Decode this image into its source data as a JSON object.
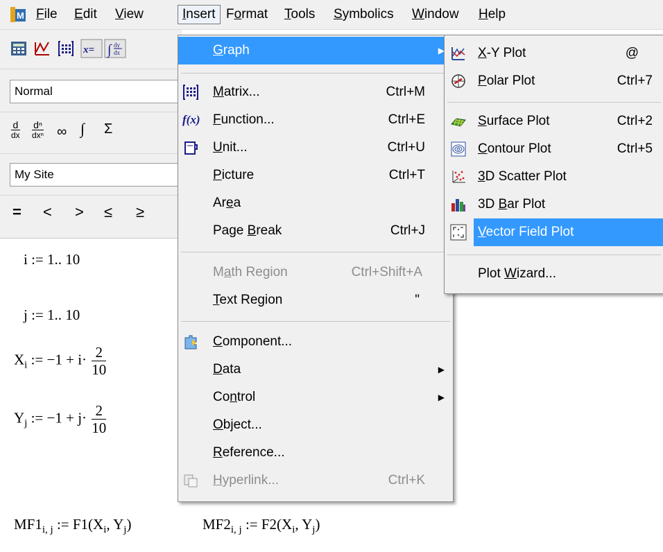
{
  "menubar": {
    "items": [
      {
        "label": "File",
        "mn": "F",
        "rest": "ile"
      },
      {
        "label": "Edit",
        "mn": "E",
        "rest": "dit"
      },
      {
        "label": "View",
        "mn": "V",
        "rest": "iew"
      },
      {
        "label": "Insert",
        "mn": "I",
        "rest": "nsert"
      },
      {
        "label": "Format",
        "pre": "F",
        "mn": "o",
        "rest": "rmat"
      },
      {
        "label": "Tools",
        "mn": "T",
        "rest": "ools"
      },
      {
        "label": "Symbolics",
        "mn": "S",
        "rest": "ymbolics"
      },
      {
        "label": "Window",
        "mn": "W",
        "rest": "indow"
      },
      {
        "label": "Help",
        "mn": "H",
        "rest": "elp"
      }
    ]
  },
  "toolbar": {
    "style_value": "Normal",
    "site_value": "My Site",
    "calculus_symbols": [
      "d/dx",
      "dⁿ/dxⁿ",
      "∞",
      "∫",
      "Σ"
    ],
    "boolean_symbols": [
      "=",
      "<",
      ">",
      "≤",
      "≥"
    ]
  },
  "worksheet": {
    "line1": "i := 1.. 10",
    "line2": "j := 1.. 10",
    "x_def": {
      "lhs": "X",
      "sub": "i",
      "rhs": ":= −1 + i·",
      "num": "2",
      "den": "10"
    },
    "y_def": {
      "lhs": "Y",
      "sub": "j",
      "rhs": ":= −1 + j·",
      "num": "2",
      "den": "10"
    },
    "mf1": {
      "name": "MF1",
      "sub": "i, j",
      "rhs": ":= F1(X",
      "a": "i",
      ",": ", Y",
      "b": "j",
      ")": ")"
    },
    "mf2": {
      "name": "MF2",
      "sub": "i, j",
      "rhs": ":= F2(X",
      "a": "i",
      ",": ", Y",
      "b": "j",
      ")": ")"
    }
  },
  "insert_menu": {
    "items": [
      {
        "pre": "",
        "mn": "G",
        "rest": "raph",
        "shortcut": "",
        "submenu": true,
        "highlighted": true,
        "icon": ""
      },
      {
        "pre": "",
        "mn": "M",
        "rest": "atrix...",
        "shortcut": "Ctrl+M",
        "icon": "matrix-icon"
      },
      {
        "pre": "",
        "mn": "F",
        "rest": "unction...",
        "shortcut": "Ctrl+E",
        "icon": "function-icon"
      },
      {
        "pre": "",
        "mn": "U",
        "rest": "nit...",
        "shortcut": "Ctrl+U",
        "icon": "unit-icon"
      },
      {
        "pre": "",
        "mn": "P",
        "rest": "icture",
        "shortcut": "Ctrl+T",
        "icon": ""
      },
      {
        "pre": "Ar",
        "mn": "e",
        "rest": "a",
        "shortcut": "",
        "icon": ""
      },
      {
        "pre": "Page ",
        "mn": "B",
        "rest": "reak",
        "shortcut": "Ctrl+J",
        "icon": ""
      },
      {
        "pre": "M",
        "mn": "a",
        "rest": "th Region",
        "shortcut": "Ctrl+Shift+A",
        "disabled": true,
        "icon": ""
      },
      {
        "pre": "",
        "mn": "T",
        "rest": "ext Region",
        "shortcut": "\"",
        "icon": ""
      },
      {
        "pre": "",
        "mn": "C",
        "rest": "omponent...",
        "shortcut": "",
        "icon": "component-icon"
      },
      {
        "pre": "",
        "mn": "D",
        "rest": "ata",
        "shortcut": "",
        "submenu": true,
        "icon": ""
      },
      {
        "pre": "Co",
        "mn": "n",
        "rest": "trol",
        "shortcut": "",
        "submenu": true,
        "icon": ""
      },
      {
        "pre": "",
        "mn": "O",
        "rest": "bject...",
        "shortcut": "",
        "icon": ""
      },
      {
        "pre": "",
        "mn": "R",
        "rest": "eference...",
        "shortcut": "",
        "icon": ""
      },
      {
        "pre": "",
        "mn": "H",
        "rest": "yperlink...",
        "shortcut": "Ctrl+K",
        "disabled": true,
        "icon": "hyperlink-icon"
      }
    ]
  },
  "graph_submenu": {
    "items": [
      {
        "pre": "",
        "mn": "X",
        "rest": "-Y Plot",
        "shortcut": "@",
        "icon": "xy-plot-icon"
      },
      {
        "pre": "",
        "mn": "P",
        "rest": "olar Plot",
        "shortcut": "Ctrl+7",
        "icon": "polar-plot-icon"
      },
      {
        "pre": "",
        "mn": "S",
        "rest": "urface Plot",
        "shortcut": "Ctrl+2",
        "icon": "surface-plot-icon"
      },
      {
        "pre": "",
        "mn": "C",
        "rest": "ontour Plot",
        "shortcut": "Ctrl+5",
        "icon": "contour-plot-icon"
      },
      {
        "pre": "",
        "mn": "3",
        "rest": "D Scatter Plot",
        "shortcut": "",
        "icon": "scatter-plot-icon"
      },
      {
        "pre": "3D ",
        "mn": "B",
        "rest": "ar Plot",
        "shortcut": "",
        "icon": "bar-plot-icon"
      },
      {
        "pre": "",
        "mn": "V",
        "rest": "ector Field Plot",
        "shortcut": "",
        "highlighted": true,
        "icon": "vector-field-icon"
      },
      {
        "pre": "Plot ",
        "mn": "W",
        "rest": "izard...",
        "shortcut": "",
        "icon": ""
      }
    ]
  }
}
